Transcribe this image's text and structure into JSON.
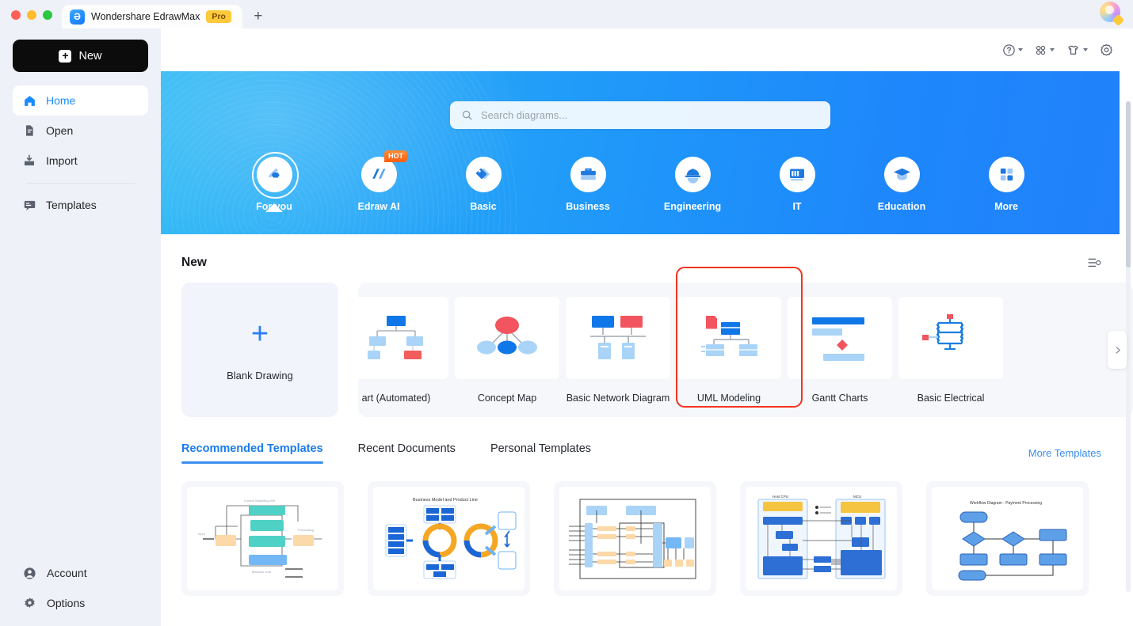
{
  "window": {
    "tab_title": "Wondershare EdrawMax",
    "pro_badge": "Pro",
    "new_tab_label": "+",
    "logo_glyph": "Ə"
  },
  "sidebar": {
    "new_button": "New",
    "items": [
      {
        "label": "Home",
        "icon": "home-icon",
        "active": true
      },
      {
        "label": "Open",
        "icon": "document-icon",
        "active": false
      },
      {
        "label": "Import",
        "icon": "import-icon",
        "active": false
      },
      {
        "label": "Templates",
        "icon": "templates-icon",
        "active": false
      }
    ],
    "bottom_items": [
      {
        "label": "Account",
        "icon": "account-icon"
      },
      {
        "label": "Options",
        "icon": "gear-icon"
      }
    ]
  },
  "topbar": {
    "help_icon": "help-circle-icon",
    "apps_icon": "grid-apps-icon",
    "theme_icon": "shirt-theme-icon",
    "settings_icon": "gear-icon"
  },
  "banner": {
    "search": {
      "placeholder": "Search diagrams...",
      "value": "",
      "icon": "search-icon"
    },
    "categories": [
      {
        "label": "For you",
        "icon": "for-you-icon",
        "selected": true,
        "badge": ""
      },
      {
        "label": "Edraw AI",
        "icon": "edraw-ai-icon",
        "selected": false,
        "badge": "HOT"
      },
      {
        "label": "Basic",
        "icon": "basic-icon",
        "selected": false,
        "badge": ""
      },
      {
        "label": "Business",
        "icon": "business-icon",
        "selected": false,
        "badge": ""
      },
      {
        "label": "Engineering",
        "icon": "engineering-icon",
        "selected": false,
        "badge": ""
      },
      {
        "label": "IT",
        "icon": "it-icon",
        "selected": false,
        "badge": ""
      },
      {
        "label": "Education",
        "icon": "education-icon",
        "selected": false,
        "badge": ""
      },
      {
        "label": "More",
        "icon": "more-grid-icon",
        "selected": false,
        "badge": ""
      }
    ]
  },
  "new_section": {
    "title": "New",
    "list_settings_icon": "list-settings-icon",
    "blank_drawing": {
      "label": "Blank Drawing",
      "icon": "plus-icon"
    },
    "scroll_next_icon": "chevron-right-icon",
    "templates": [
      {
        "label": "art (Automated)",
        "thumb": "org-chart",
        "highlighted": false
      },
      {
        "label": "Concept Map",
        "thumb": "concept-map",
        "highlighted": false
      },
      {
        "label": "Basic Network Diagram",
        "thumb": "network",
        "highlighted": false
      },
      {
        "label": "UML Modeling",
        "thumb": "uml",
        "highlighted": true
      },
      {
        "label": "Gantt Charts",
        "thumb": "gantt",
        "highlighted": false
      },
      {
        "label": "Basic Electrical",
        "thumb": "electrical",
        "highlighted": false
      }
    ]
  },
  "tabs_section": {
    "tabs": [
      {
        "label": "Recommended Templates",
        "active": true
      },
      {
        "label": "Recent Documents",
        "active": false
      },
      {
        "label": "Personal Templates",
        "active": false
      }
    ],
    "more_templates": "More Templates",
    "recommended": [
      {
        "thumb": "control-loop"
      },
      {
        "thumb": "business-model",
        "title": "Business Model and Product Line"
      },
      {
        "thumb": "signal-block"
      },
      {
        "thumb": "host-cpu"
      },
      {
        "thumb": "workflow",
        "title": "Workflow Diagram - Payment Processing"
      }
    ]
  },
  "colors": {
    "accent_blue": "#1a8cff",
    "banner_from": "#2bb8f5",
    "banner_to": "#2181fb",
    "highlight_red": "#f5341f",
    "pro_yellow": "#ffc93c",
    "sidebar_bg": "#eef1f7"
  }
}
